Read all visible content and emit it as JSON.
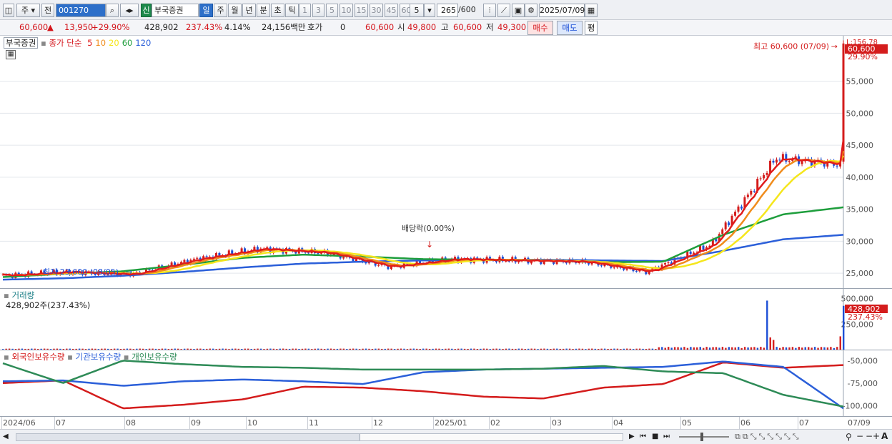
{
  "toolbar": {
    "market": "주",
    "prev": "전",
    "code": "001270",
    "badge": "신",
    "name": "부국증권",
    "periods": [
      "일",
      "주",
      "월",
      "년",
      "분",
      "초",
      "틱"
    ],
    "active_period": "일",
    "minute_steps": [
      "1",
      "3",
      "5",
      "10",
      "15",
      "30",
      "45",
      "60"
    ],
    "step_value": "5",
    "count": "265",
    "count_max": "/600",
    "date": "2025/07/09"
  },
  "info": {
    "price": "60,600",
    "change": "13,950",
    "change_pct": "+29.90%",
    "volume": "428,902",
    "volume_ratio": "237.43%",
    "turnover": "4.14%",
    "trade_value": "24,156백만",
    "ask_label": "호가",
    "ask_value": "0",
    "ask_price": "60,600",
    "open_label": "시",
    "open": "49,800",
    "high_label": "고",
    "high": "60,600",
    "low_label": "저",
    "low": "49,300",
    "buy": "매수",
    "sell": "매도",
    "eval": "평"
  },
  "price_panel": {
    "name_tag": "부국증권",
    "ma_label": "종가 단순",
    "ma_periods": [
      "5",
      "10",
      "20",
      "60",
      "120"
    ],
    "ma_colors": [
      "#e01c1c",
      "#f08c1c",
      "#f5e61c",
      "#1e9e3c",
      "#2b5fd9"
    ],
    "corner_label": "L:156.78",
    "high_annotation": "최고 60,600 (07/09)",
    "low_annotation": "최저 23,600 (08/05)",
    "dividend_annotation": "배당락(0.00%)",
    "last_price_tag": "60,600",
    "last_pct_tag": "29.90%",
    "y_ticks": [
      "55,000",
      "50,000",
      "45,000",
      "40,000",
      "35,000",
      "30,000",
      "25,000"
    ]
  },
  "volume_panel": {
    "title": "거래량",
    "value": "428,902주(237.43%)",
    "y_ticks": [
      "500,000",
      "250,000"
    ],
    "last_tag": "428,902",
    "last_pct_tag": "237.43%"
  },
  "holdings_panel": {
    "labels": [
      "외국인보유수량",
      "기관보유수량",
      "개인보유수량"
    ],
    "colors": [
      "#d41c1c",
      "#2b5fd9",
      "#2e8b57"
    ],
    "y_ticks": [
      "-50,000",
      "-75,000",
      "-100,000"
    ]
  },
  "x_axis": {
    "labels": [
      "2024/06",
      "07",
      "08",
      "09",
      "10",
      "11",
      "12",
      "2025/01",
      "02",
      "03",
      "04",
      "05",
      "06",
      "07"
    ],
    "last_label": "07/09"
  },
  "chart_data": {
    "type": "line",
    "title": "부국증권",
    "x": [
      "2024/06",
      "07",
      "08",
      "09",
      "10",
      "11",
      "12",
      "2025/01",
      "02",
      "03",
      "04",
      "05",
      "06",
      "07",
      "07/09"
    ],
    "series": [
      {
        "name": "종가",
        "values": [
          24600,
          25200,
          24800,
          27200,
          28800,
          28200,
          26000,
          27200,
          27000,
          26800,
          25200,
          29500,
          43000,
          42000,
          60600
        ]
      },
      {
        "name": "60",
        "values": [
          24400,
          24900,
          25300,
          26300,
          27400,
          27900,
          27600,
          27200,
          27100,
          27000,
          26700,
          26800,
          31000,
          34200,
          35300
        ]
      },
      {
        "name": "120",
        "values": [
          24000,
          24200,
          24600,
          25200,
          25900,
          26500,
          26800,
          27000,
          27100,
          27100,
          27000,
          26900,
          28500,
          30300,
          31000
        ]
      }
    ],
    "ylim": [
      23000,
      61000
    ],
    "volume": {
      "max_value": 500000,
      "last": 428902
    },
    "holdings": {
      "ylim": [
        -110000,
        -45000
      ],
      "series": [
        {
          "name": "외국인보유수량",
          "values": [
            -75000,
            -72000,
            -103000,
            -99000,
            -93000,
            -79000,
            -80000,
            -84000,
            -90000,
            -92000,
            -80000,
            -76000,
            -52000,
            -58000,
            -55000
          ]
        },
        {
          "name": "기관보유수량",
          "values": [
            -73000,
            -72000,
            -78000,
            -73000,
            -71000,
            -73000,
            -76000,
            -63000,
            -60000,
            -59000,
            -58000,
            -57000,
            -51000,
            -57000,
            -103000
          ]
        },
        {
          "name": "개인보유수량",
          "values": [
            -53000,
            -75000,
            -50000,
            -54000,
            -57000,
            -58000,
            -60000,
            -60000,
            -60000,
            -59000,
            -56000,
            -62000,
            -64000,
            -88000,
            -101000
          ]
        }
      ]
    }
  }
}
